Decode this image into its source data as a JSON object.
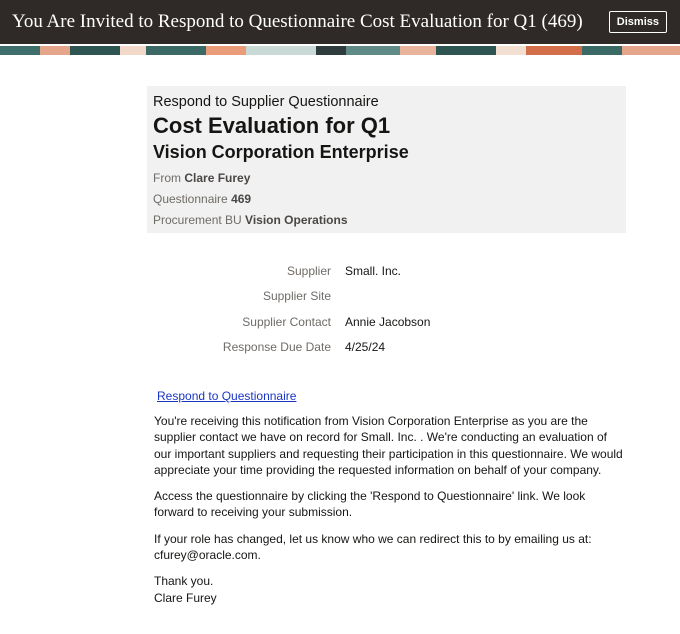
{
  "header": {
    "title": "You Are Invited to Respond to Questionnaire Cost Evaluation for Q1 (469)",
    "dismiss_label": "Dismiss"
  },
  "summary": {
    "pretitle": "Respond to Supplier Questionnaire",
    "title": "Cost Evaluation for Q1",
    "organization": "Vision Corporation Enterprise",
    "from_label": "From",
    "from_value": "Clare Furey",
    "questionnaire_label": "Questionnaire",
    "questionnaire_value": "469",
    "bu_label": "Procurement BU",
    "bu_value": "Vision Operations"
  },
  "details": [
    {
      "label": "Supplier",
      "value": "Small. Inc."
    },
    {
      "label": "Supplier Site",
      "value": ""
    },
    {
      "label": "Supplier Contact",
      "value": "Annie Jacobson"
    },
    {
      "label": "Response Due Date",
      "value": "4/25/24"
    }
  ],
  "link_label": "Respond to Questionnaire",
  "paragraphs": [
    "You're receiving this notification from Vision Corporation Enterprise as you are the supplier contact we have on record for Small. Inc. . We're conducting an evaluation of our important suppliers and requesting their participation in this questionnaire. We would appreciate your time providing the requested information on behalf of your company.",
    "Access the questionnaire by clicking the 'Respond to Questionnaire' link. We look forward to receiving your submission.",
    "If your role has changed, let us know who we can redirect this to by emailing us at: cfurey@oracle.com."
  ],
  "closing": {
    "thanks": "Thank you.",
    "signature": "Clare Furey"
  },
  "colors": {
    "header_bg": "#2f2a27",
    "summary_bg": "#f1f1f1",
    "link": "#1a35c4"
  }
}
